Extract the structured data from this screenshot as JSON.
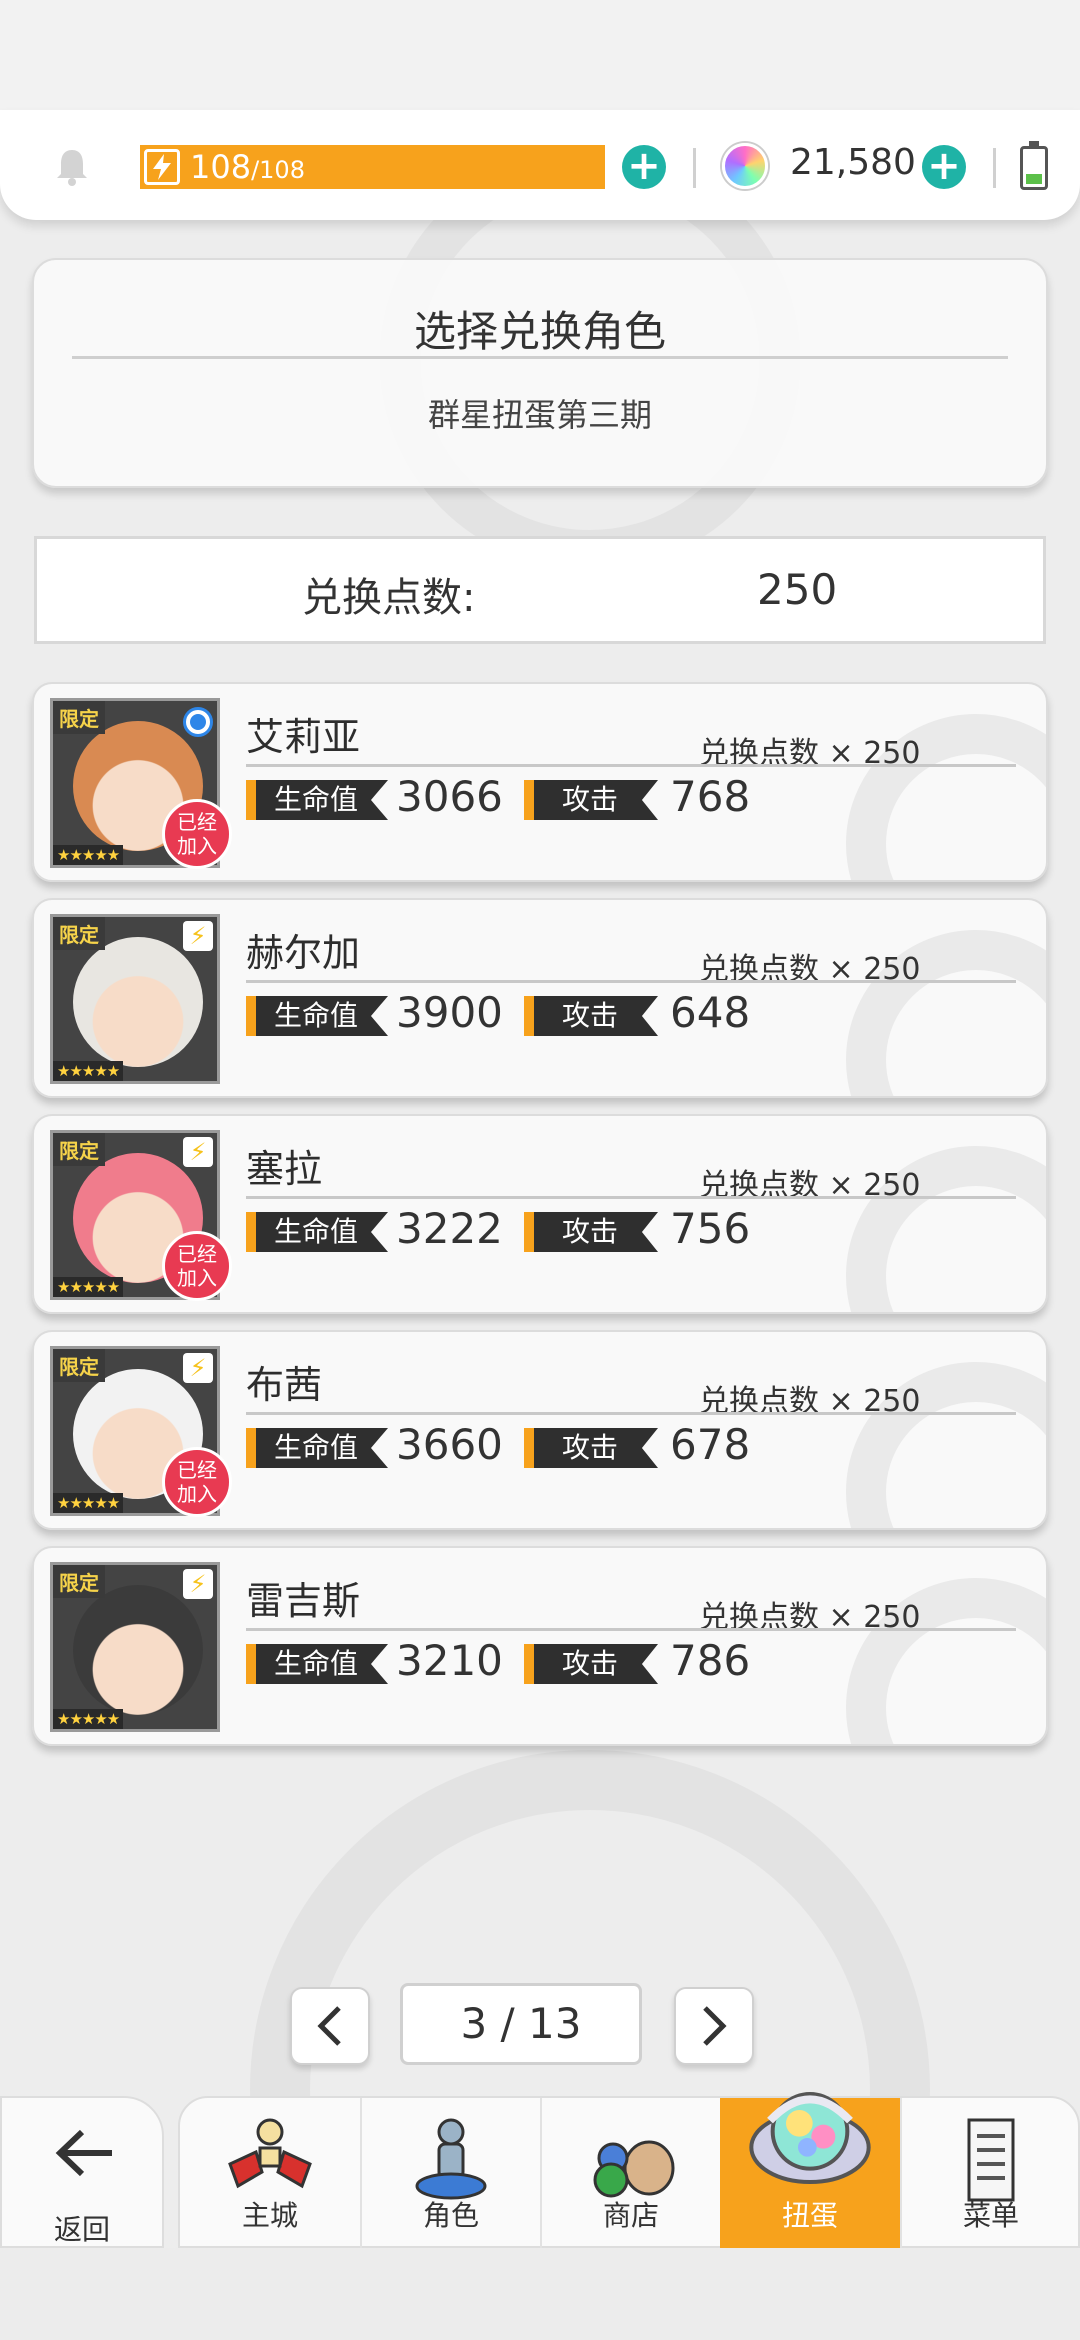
{
  "topbar": {
    "energy_current": "108",
    "energy_max": "/108",
    "gems": "21,580"
  },
  "header": {
    "title": "选择兑换角色",
    "subtitle": "群星扭蛋第三期"
  },
  "points": {
    "label": "兑换点数:",
    "value": "250"
  },
  "common": {
    "limited_tag": "限定",
    "stars": "★★★★★",
    "joined_line1": "已经",
    "joined_line2": "加入",
    "hp_label": "生命值",
    "atk_label": "攻击"
  },
  "characters": [
    {
      "name": "艾莉亚",
      "cost": "兑换点数 × 250",
      "hp": "3066",
      "atk": "768",
      "joined": true,
      "selected": true,
      "hair": "#d98a52"
    },
    {
      "name": "赫尔加",
      "cost": "兑换点数 × 250",
      "hp": "3900",
      "atk": "648",
      "joined": false,
      "selected": false,
      "hair": "#e8e6e1"
    },
    {
      "name": "塞拉",
      "cost": "兑换点数 × 250",
      "hp": "3222",
      "atk": "756",
      "joined": true,
      "selected": false,
      "hair": "#f07c8c"
    },
    {
      "name": "布茜",
      "cost": "兑换点数 × 250",
      "hp": "3660",
      "atk": "678",
      "joined": true,
      "selected": false,
      "hair": "#f2f2f2"
    },
    {
      "name": "雷吉斯",
      "cost": "兑换点数 × 250",
      "hp": "3210",
      "atk": "786",
      "joined": false,
      "selected": false,
      "hair": "#3b3b3b"
    }
  ],
  "pagination": {
    "current": "3 / 13",
    "prev_icon": "chevron-left-icon",
    "next_icon": "chevron-right-icon"
  },
  "nav": {
    "back": "返回",
    "items": [
      {
        "label": "主城",
        "icon": "castle-icon"
      },
      {
        "label": "角色",
        "icon": "character-icon"
      },
      {
        "label": "商店",
        "icon": "shop-icon"
      },
      {
        "label": "扭蛋",
        "icon": "gacha-icon",
        "active": true
      },
      {
        "label": "菜单",
        "icon": "menu-icon"
      }
    ]
  },
  "colors": {
    "accent": "#f7a21c",
    "plus": "#1fb3a6",
    "joined": "#e83a52",
    "selected": "#2e86e8"
  }
}
